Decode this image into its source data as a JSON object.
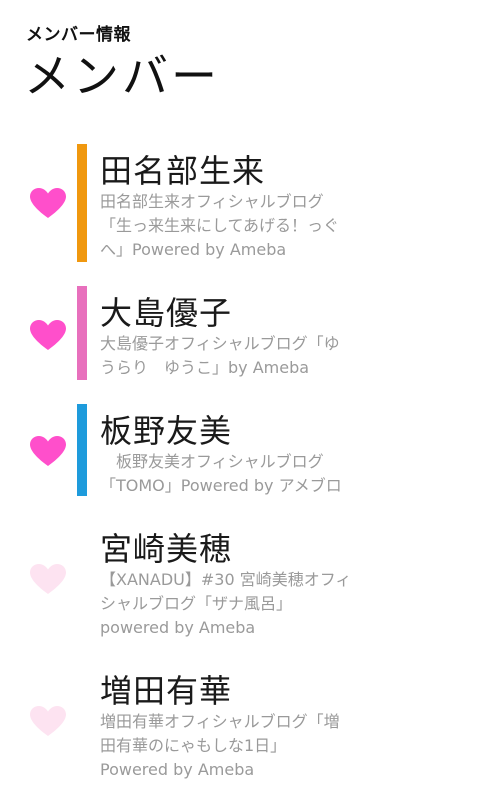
{
  "header": {
    "subtitle": "メンバー情報",
    "title": "メンバー"
  },
  "colors": {
    "heart_active": "#ff4fcb",
    "heart_inactive": "#fde3f1",
    "text_primary": "#1a1a1a",
    "text_secondary": "#9a9a9a"
  },
  "members": [
    {
      "name": "田名部生来",
      "blog_lines": [
        "田名部生来オフィシャルブログ",
        "「生っ来生来にしてあげる！っぐ",
        "へ」Powered by Ameba"
      ],
      "favorite": true,
      "heart_icon": "heart-filled-icon",
      "accent_color": "#f0980f"
    },
    {
      "name": "大島優子",
      "blog_lines": [
        "大島優子オフィシャルブログ「ゆ",
        "うらり　ゆうこ」by Ameba"
      ],
      "favorite": true,
      "heart_icon": "heart-filled-icon",
      "accent_color": "#e870bd"
    },
    {
      "name": "板野友美",
      "blog_lines": [
        "　板野友美オフィシャルブログ",
        "「TOMO」Powered by アメブロ"
      ],
      "favorite": true,
      "heart_icon": "heart-filled-icon",
      "accent_color": "#1e9bdc"
    },
    {
      "name": "宮崎美穂",
      "blog_lines": [
        "【XANADU】#30 宮崎美穂オフィ",
        "シャルブログ「ザナ風呂」",
        "powered by Ameba"
      ],
      "favorite": false,
      "heart_icon": "heart-outline-icon",
      "accent_color": ""
    },
    {
      "name": "増田有華",
      "blog_lines": [
        "増田有華オフィシャルブログ「増",
        "田有華のにゃもしな1日」",
        "Powered by Ameba"
      ],
      "favorite": false,
      "heart_icon": "heart-outline-icon",
      "accent_color": ""
    }
  ]
}
